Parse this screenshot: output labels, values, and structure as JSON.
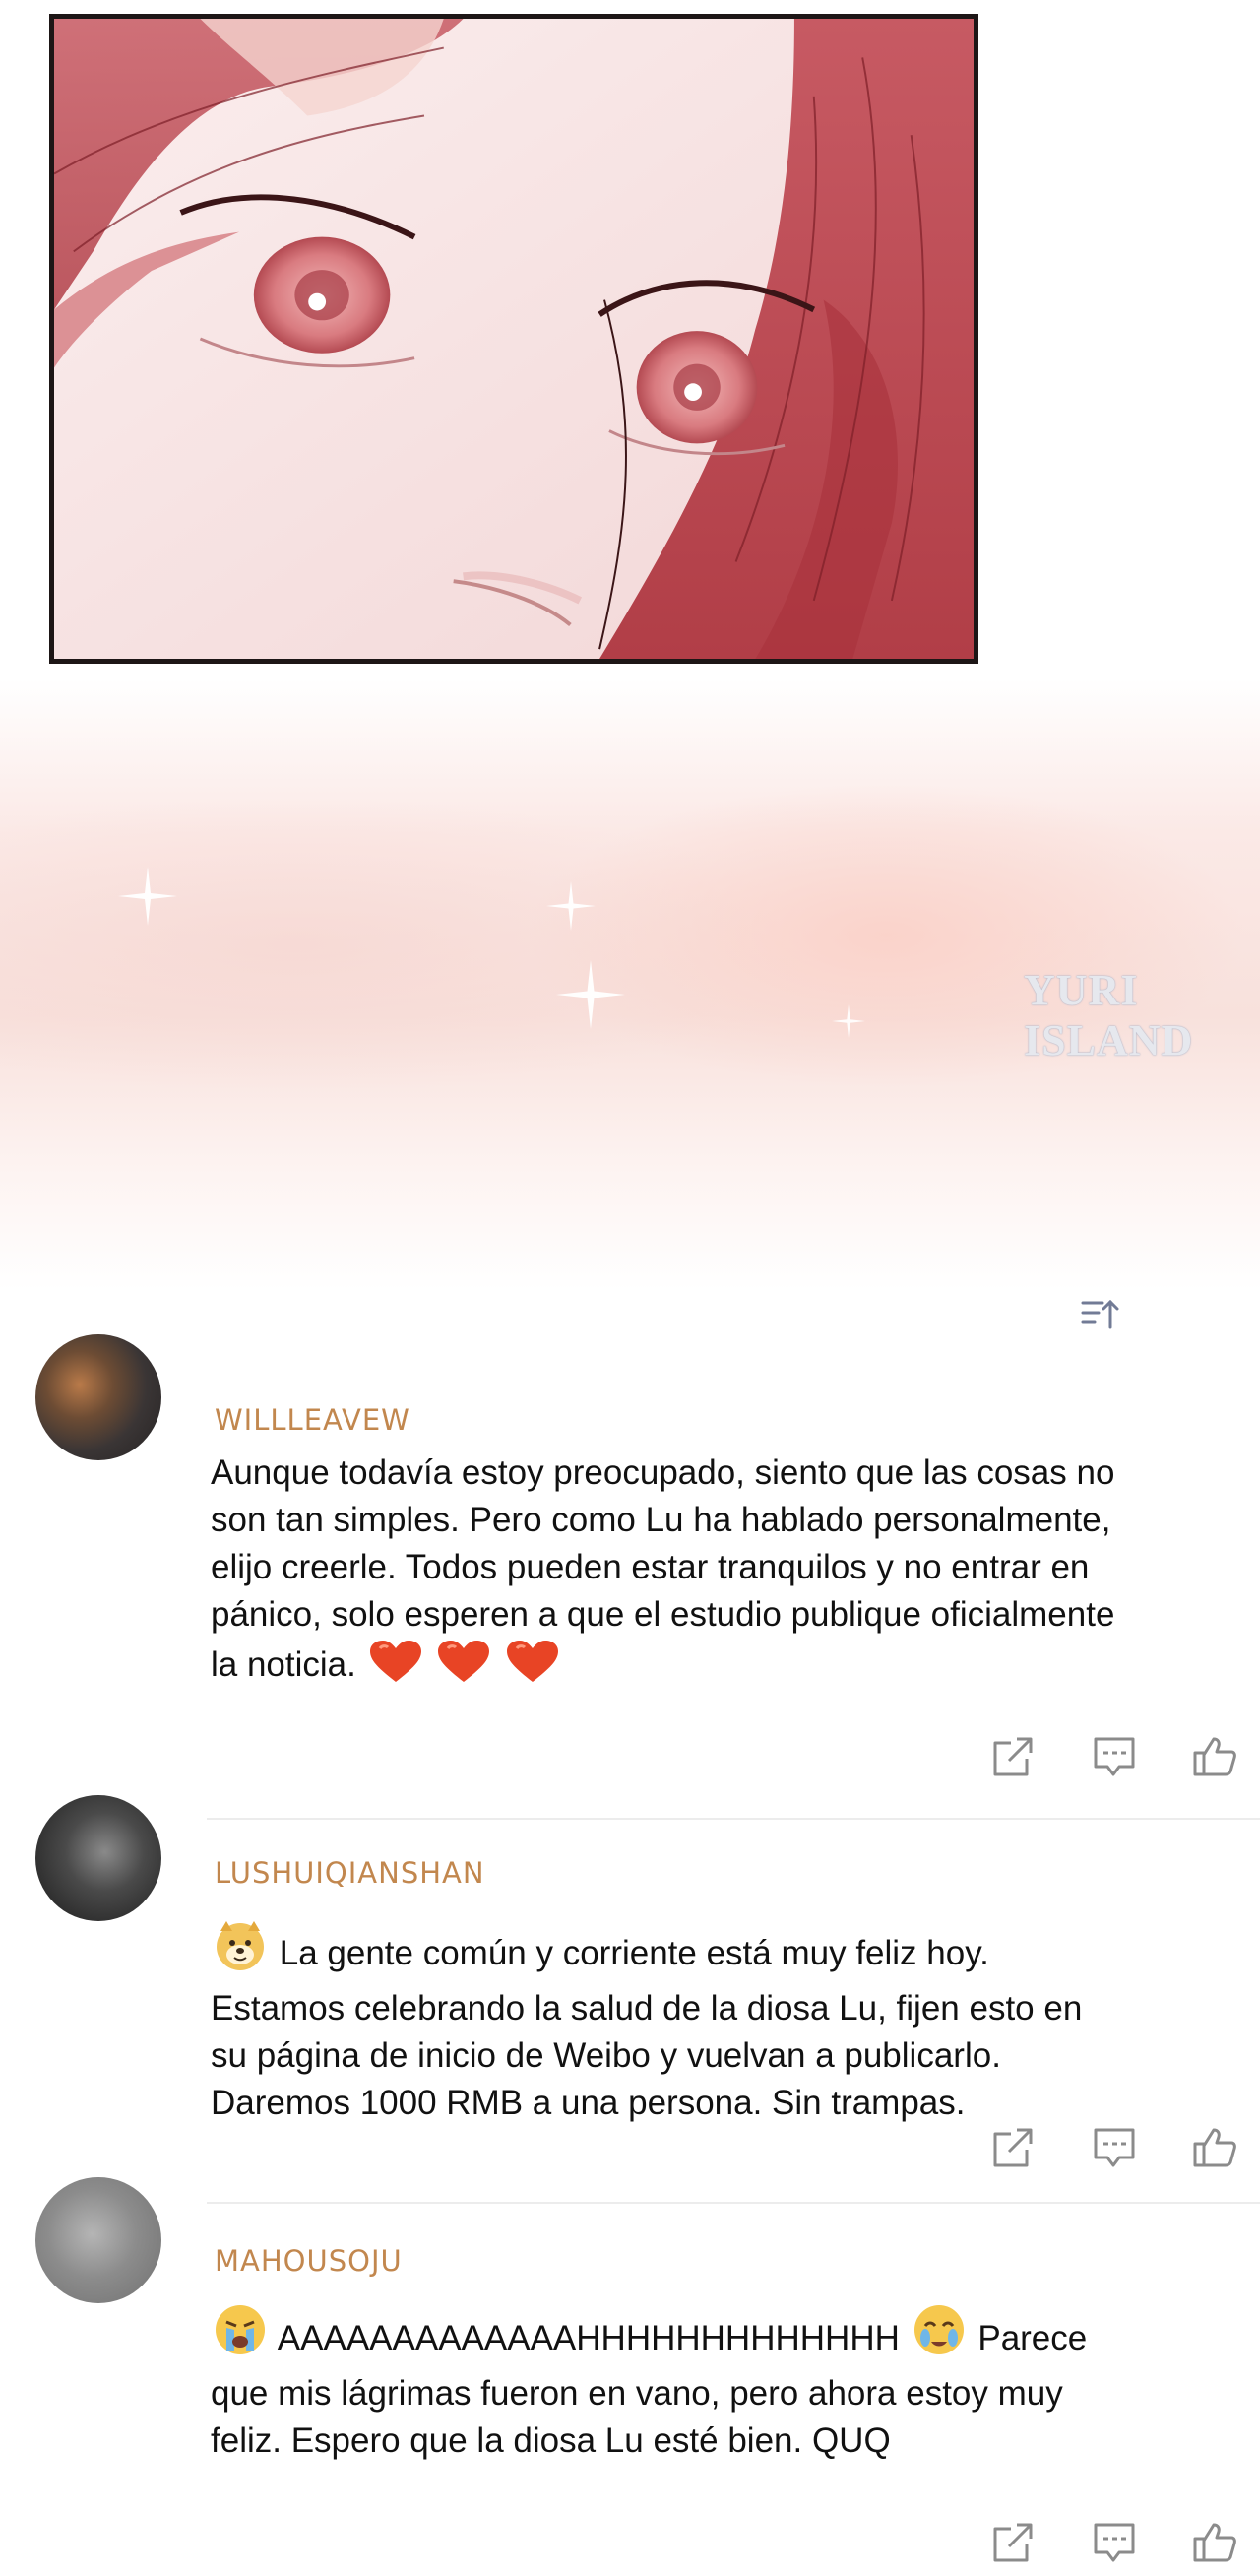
{
  "artwork": {
    "watermark": "YURI ISLAND",
    "colors": {
      "hair": "#c4555b",
      "skin": "#f7e6e6",
      "eye": "#d98a8a",
      "border": "#1d1616",
      "glow": "#f8ddd6"
    }
  },
  "comment_section": {
    "sort_icon": "sort-icon",
    "comments": [
      {
        "username": "WILLLEAVEW",
        "text": "Aunque todavía estoy preocupado, siento que las cosas no son tan simples. Pero como Lu ha hablado personalmente, elijo creerle. Todos pueden estar tranquilos y no entrar en pánico, solo esperen a que el estudio publique oficialmente la noticia.",
        "trailing_emoji": [
          "heart-emoji",
          "heart-emoji",
          "heart-emoji"
        ]
      },
      {
        "username": "LUSHUIQIANSHAN",
        "leading_emoji": "doge-emoji",
        "text": "La gente común y corriente está muy feliz hoy. Estamos celebrando la salud de la diosa Lu, fijen esto en su página de inicio de Weibo y vuelvan a publicarlo. Daremos 1000 RMB a una persona. Sin trampas."
      },
      {
        "username": "MAHOUSOJU",
        "leading_emoji": "crying-face-emoji",
        "text_before": "AAAAAAAAAAAAAHHHHHHHHHHHHH",
        "mid_emoji": "teary-smile-emoji",
        "text_after": "Parece que mis lágrimas fueron en vano, pero ahora estoy muy feliz. Espero que la diosa Lu esté bien. QUQ"
      }
    ],
    "action_icons": [
      "share-icon",
      "comment-icon",
      "like-icon"
    ],
    "accent_color": "#c2874e"
  }
}
